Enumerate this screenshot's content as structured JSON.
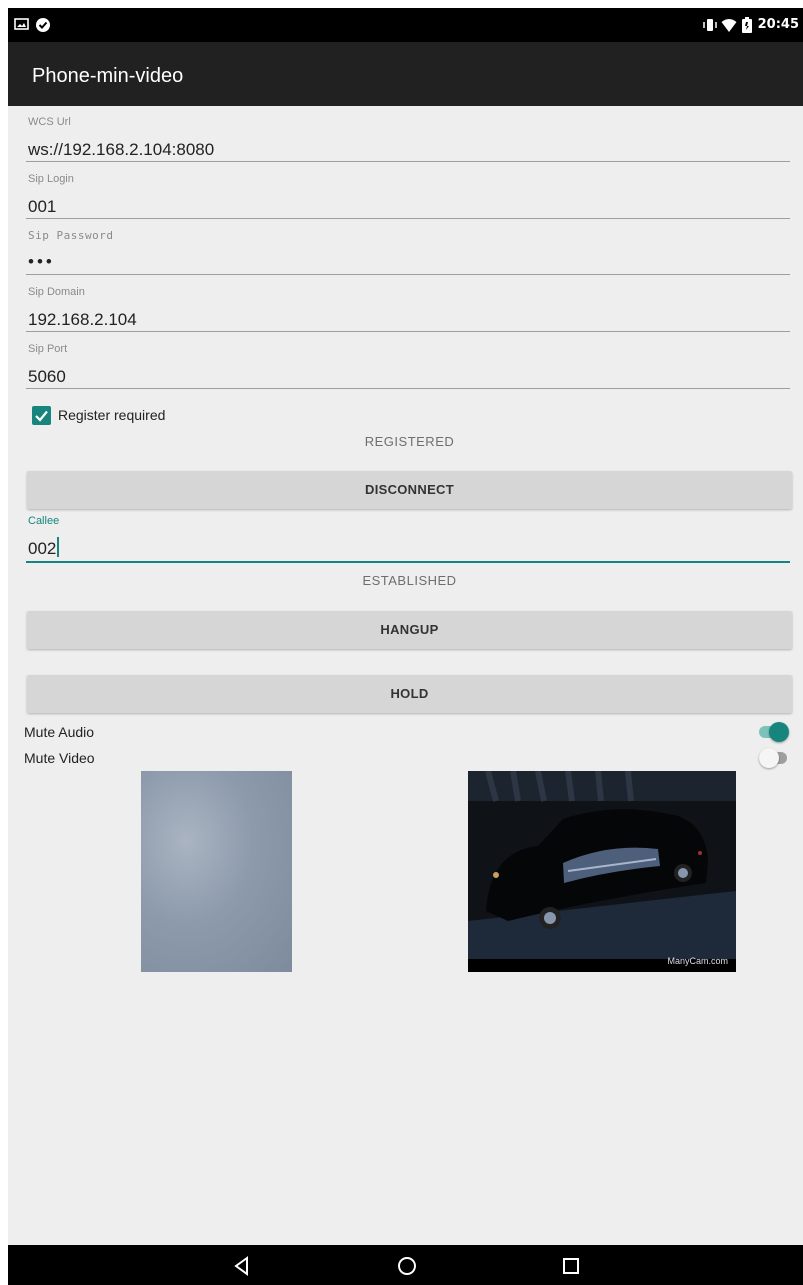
{
  "status_bar": {
    "time": "20:45",
    "icons": [
      "image-notification-icon",
      "check-badge-icon",
      "vibrate-icon",
      "wifi-icon",
      "battery-icon"
    ]
  },
  "app_bar": {
    "title": "Phone-min-video"
  },
  "form": {
    "wcs_url": {
      "label": "WCS Url",
      "value": "ws://192.168.2.104:8080"
    },
    "sip_login": {
      "label": "Sip Login",
      "value": "001"
    },
    "sip_password": {
      "label": "Sip Password",
      "value": "•••"
    },
    "sip_domain": {
      "label": "Sip Domain",
      "value": "192.168.2.104"
    },
    "sip_port": {
      "label": "Sip Port",
      "value": "5060"
    },
    "register_required": {
      "label": "Register required",
      "checked": true
    }
  },
  "connection": {
    "status": "REGISTERED",
    "button_label": "DISCONNECT"
  },
  "call": {
    "callee_label": "Callee",
    "callee_value": "002",
    "status": "ESTABLISHED",
    "hangup_label": "HANGUP",
    "hold_label": "HOLD"
  },
  "toggles": {
    "mute_audio": {
      "label": "Mute Audio",
      "on": true
    },
    "mute_video": {
      "label": "Mute Video",
      "on": false
    }
  },
  "video": {
    "remote_watermark": "ManyCam.com"
  },
  "colors": {
    "accent": "#17857d",
    "app_bar": "#212121",
    "background": "#eeeeee",
    "button": "#d6d6d6"
  },
  "nav_bar": {
    "icons": [
      "back-icon",
      "home-icon",
      "recents-icon"
    ]
  }
}
